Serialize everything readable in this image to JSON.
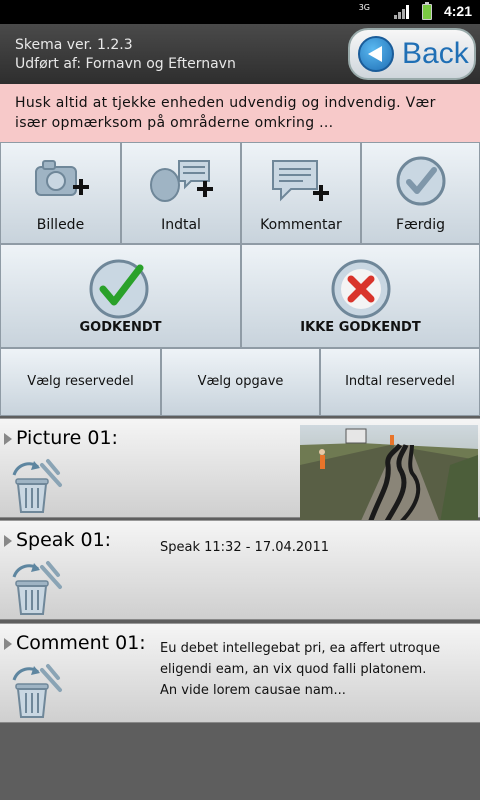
{
  "status_bar": {
    "network": "3G",
    "time": "4:21"
  },
  "header": {
    "version": "Skema ver.  1.2.3",
    "performed_by": "Udført af: Fornavn og Efternavn",
    "back_label": "Back"
  },
  "notice": {
    "line1": "Husk altid at tjekke enheden udvendig og indvendig. Vær",
    "line2": "især opmærksom på områderne omkring ..."
  },
  "actions": {
    "picture": "Billede",
    "speak": "Indtal",
    "comment": "Kommentar",
    "done": "Færdig"
  },
  "approval": {
    "approved": "GODKENDT",
    "not_approved": "IKKE GODKENDT"
  },
  "selectors": {
    "spare_part": "Vælg reservedel",
    "task": "Vælg opgave",
    "speak_spare_part": "Indtal reservedel"
  },
  "entries": [
    {
      "title": "Picture 01:",
      "text": ""
    },
    {
      "title": "Speak 01:",
      "text": "Speak 11:32 - 17.04.2011"
    },
    {
      "title": "Comment 01:",
      "line1": "Eu debet intellegebat pri, ea affert utroque",
      "line2": "eligendi eam, an vix quod falli platonem.",
      "line3": "An vide lorem causae nam..."
    }
  ],
  "colors": {
    "notice_bg": "#f7c9c9",
    "approve_green": "#2aa12a",
    "reject_red": "#d9342b",
    "accent_blue": "#1f6fb5"
  }
}
